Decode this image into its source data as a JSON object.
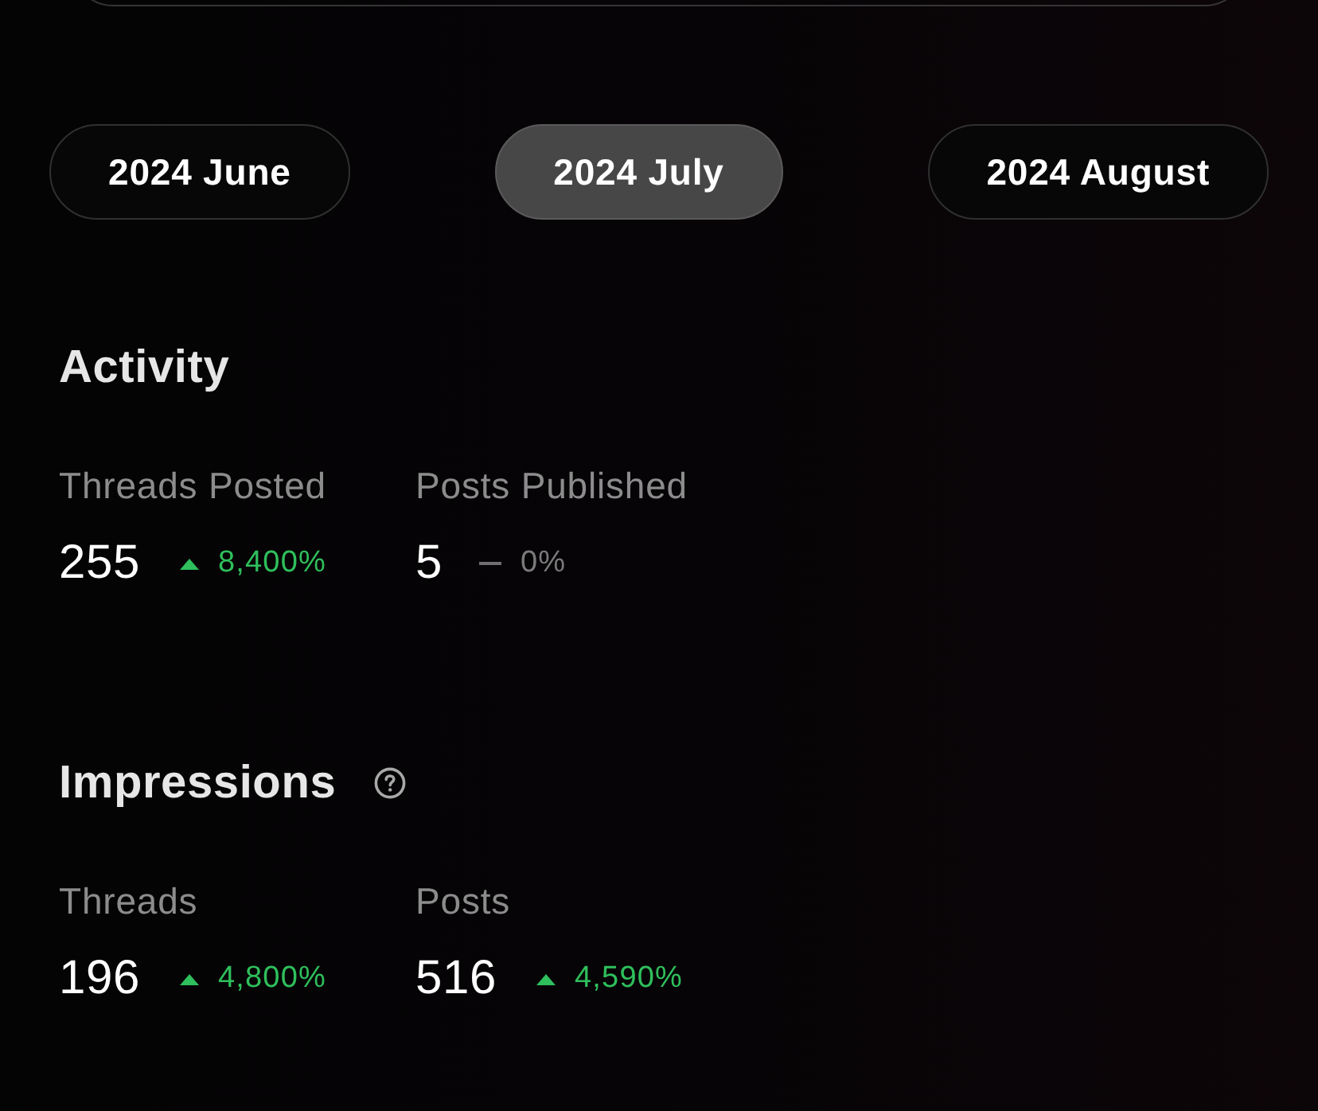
{
  "months": [
    {
      "label": "2024 June",
      "selected": false
    },
    {
      "label": "2024 July",
      "selected": true
    },
    {
      "label": "2024 August",
      "selected": false
    }
  ],
  "activity": {
    "title": "Activity",
    "metrics": [
      {
        "label": "Threads Posted",
        "value": "255",
        "kind": "up",
        "change": "8,400%"
      },
      {
        "label": "Posts Published",
        "value": "5",
        "kind": "flat",
        "change": "0%"
      }
    ]
  },
  "impressions": {
    "title": "Impressions",
    "help_icon": true,
    "metrics": [
      {
        "label": "Threads",
        "value": "196",
        "kind": "up",
        "change": "4,800%"
      },
      {
        "label": "Posts",
        "value": "516",
        "kind": "up",
        "change": "4,590%"
      }
    ]
  }
}
